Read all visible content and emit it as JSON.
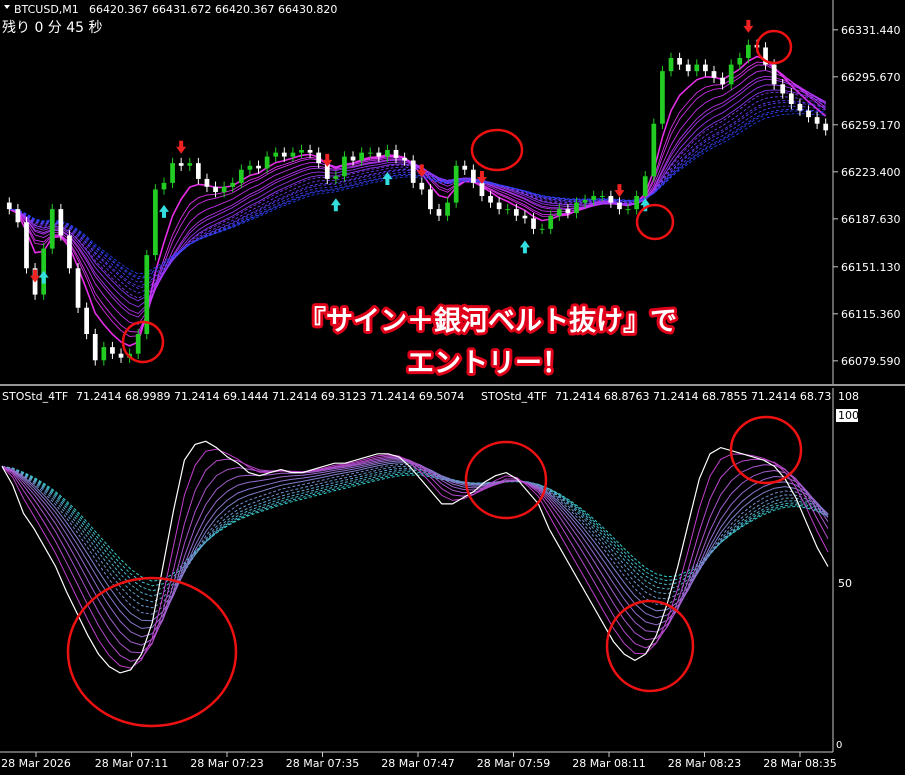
{
  "header": {
    "symbol_info": "BTCUSD,M1",
    "ohlc": "66420.367 66431.672 66420.367 66430.820",
    "countdown": "残り 0 分 45 秒"
  },
  "indicator": {
    "label1": "STOStd_4TF",
    "values1": "71.2414 68.9989 71.2414 69.1444 71.2414 69.3123 71.2414 69.5074",
    "label2": "STOStd_4TF",
    "values2": "71.2414 68.8763 71.2414 68.7855 71.2414 68.73",
    "scale_top": "108",
    "level_100": "100",
    "level_50": "50",
    "level_0": "0"
  },
  "callout": {
    "line1": "『サイン＋銀河ベルト抜け』で",
    "line2": "エントリー！"
  },
  "colors": {
    "background": "#000000",
    "bull": "#22cc22",
    "bear": "#ffffff",
    "belt_fast": "#ff33ff",
    "belt_slow": "#2244ff",
    "sto_fast": "#cc33cc",
    "sto_slow": "#33cccc",
    "sto_main": "#ffffff",
    "buy_arrow": "#33dddd",
    "sell_arrow": "#ee2222",
    "highlight": "#ee1111",
    "separator": "#c8c8c8"
  },
  "chart_data": [
    {
      "type": "candlestick",
      "symbol": "BTCUSD",
      "timeframe": "M1",
      "y_ticks": [
        66331.44,
        66295.67,
        66259.17,
        66223.4,
        66187.63,
        66151.13,
        66115.36,
        66079.59
      ],
      "ylim": [
        66065,
        66345
      ],
      "x_ticks": [
        "28 Mar 2026",
        "28 Mar 07:11",
        "28 Mar 07:23",
        "28 Mar 07:35",
        "28 Mar 07:47",
        "28 Mar 07:59",
        "28 Mar 08:11",
        "28 Mar 08:23",
        "28 Mar 08:35"
      ],
      "close": [
        66195,
        66185,
        66150,
        66130,
        66165,
        66195,
        66175,
        66150,
        66120,
        66100,
        66080,
        66090,
        66085,
        66082,
        66085,
        66100,
        66160,
        66210,
        66215,
        66230,
        66228,
        66230,
        66218,
        66212,
        66208,
        66212,
        66215,
        66225,
        66228,
        66226,
        66235,
        66238,
        66235,
        66238,
        66240,
        66238,
        66230,
        66218,
        66220,
        66235,
        66232,
        66238,
        66238,
        66235,
        66240,
        66234,
        66232,
        66215,
        66210,
        66195,
        66190,
        66200,
        66228,
        66225,
        66215,
        66205,
        66200,
        66195,
        66195,
        66190,
        66188,
        66180,
        66180,
        66190,
        66195,
        66192,
        66200,
        66202,
        66205,
        66205,
        66200,
        66195,
        66195,
        66205,
        66220,
        66260,
        66300,
        66310,
        66305,
        66300,
        66305,
        66300,
        66295,
        66290,
        66305,
        66310,
        66320,
        66318,
        66305,
        66290,
        66283,
        66275,
        66270,
        66265,
        66260,
        66255
      ],
      "buy_signals": [
        4,
        18,
        38,
        44,
        60,
        74
      ],
      "sell_signals": [
        3,
        20,
        37,
        48,
        55,
        71,
        86
      ],
      "belt_fast_period": 5,
      "belt_slow_period": 30
    },
    {
      "type": "line",
      "indicator": "STOStd_4TF",
      "ylim": [
        0,
        108
      ],
      "levels": [
        100,
        50,
        0
      ],
      "series": [
        {
          "values": [
            90,
            84,
            75,
            70,
            64,
            58,
            50,
            43,
            36,
            30,
            26,
            24,
            25,
            30,
            40,
            58,
            76,
            92,
            97,
            98,
            96,
            93,
            91,
            88,
            87,
            88,
            89,
            88,
            88,
            89,
            90,
            91,
            91,
            92,
            93,
            94,
            94,
            93,
            90,
            86,
            82,
            78,
            78,
            80,
            82,
            85,
            87,
            88,
            86,
            82,
            78,
            70,
            64,
            58,
            52,
            46,
            40,
            34,
            30,
            28,
            30,
            36,
            46,
            58,
            72,
            86,
            94,
            96,
            95,
            94,
            93,
            92,
            90,
            86,
            80,
            72,
            64,
            58
          ]
        }
      ]
    }
  ]
}
